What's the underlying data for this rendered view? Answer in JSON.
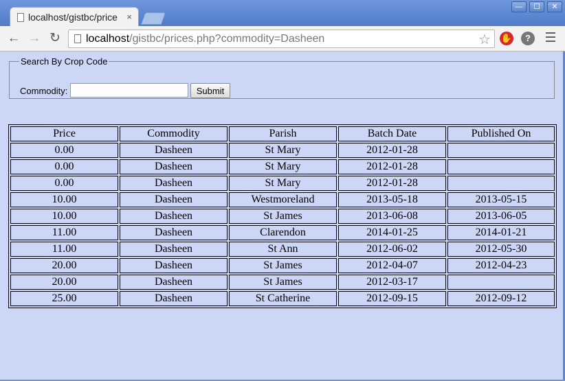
{
  "tab": {
    "title": "localhost/gistbc/price",
    "close": "×"
  },
  "window": {
    "minimize": "—",
    "maximize": "☐",
    "close": "✕"
  },
  "nav": {
    "back": "←",
    "forward": "→",
    "reload": "↻",
    "menu": "☰"
  },
  "address": {
    "host": "localhost",
    "path": "/gistbc/prices.php?commodity=Dasheen",
    "star": "☆"
  },
  "extensions": {
    "stop": "✋",
    "help": "?"
  },
  "search": {
    "legend": "Search By Crop Code",
    "label": "Commodity:",
    "value": "",
    "submit": "Submit"
  },
  "table": {
    "headers": [
      "Price",
      "Commodity",
      "Parish",
      "Batch Date",
      "Published On"
    ],
    "rows": [
      [
        "0.00",
        "Dasheen",
        "St Mary",
        "2012-01-28",
        ""
      ],
      [
        "0.00",
        "Dasheen",
        "St Mary",
        "2012-01-28",
        ""
      ],
      [
        "0.00",
        "Dasheen",
        "St Mary",
        "2012-01-28",
        ""
      ],
      [
        "10.00",
        "Dasheen",
        "Westmoreland",
        "2013-05-18",
        "2013-05-15"
      ],
      [
        "10.00",
        "Dasheen",
        "St James",
        "2013-06-08",
        "2013-06-05"
      ],
      [
        "11.00",
        "Dasheen",
        "Clarendon",
        "2014-01-25",
        "2014-01-21"
      ],
      [
        "11.00",
        "Dasheen",
        "St Ann",
        "2012-06-02",
        "2012-05-30"
      ],
      [
        "20.00",
        "Dasheen",
        "St James",
        "2012-04-07",
        "2012-04-23"
      ],
      [
        "20.00",
        "Dasheen",
        "St James",
        "2012-03-17",
        ""
      ],
      [
        "25.00",
        "Dasheen",
        "St Catherine",
        "2012-09-15",
        "2012-09-12"
      ]
    ]
  },
  "colors": {
    "page_bg": "#ccd6f6",
    "titlebar": "#5b86d0",
    "stop_ext": "#d9262c",
    "help_ext": "#777777"
  }
}
